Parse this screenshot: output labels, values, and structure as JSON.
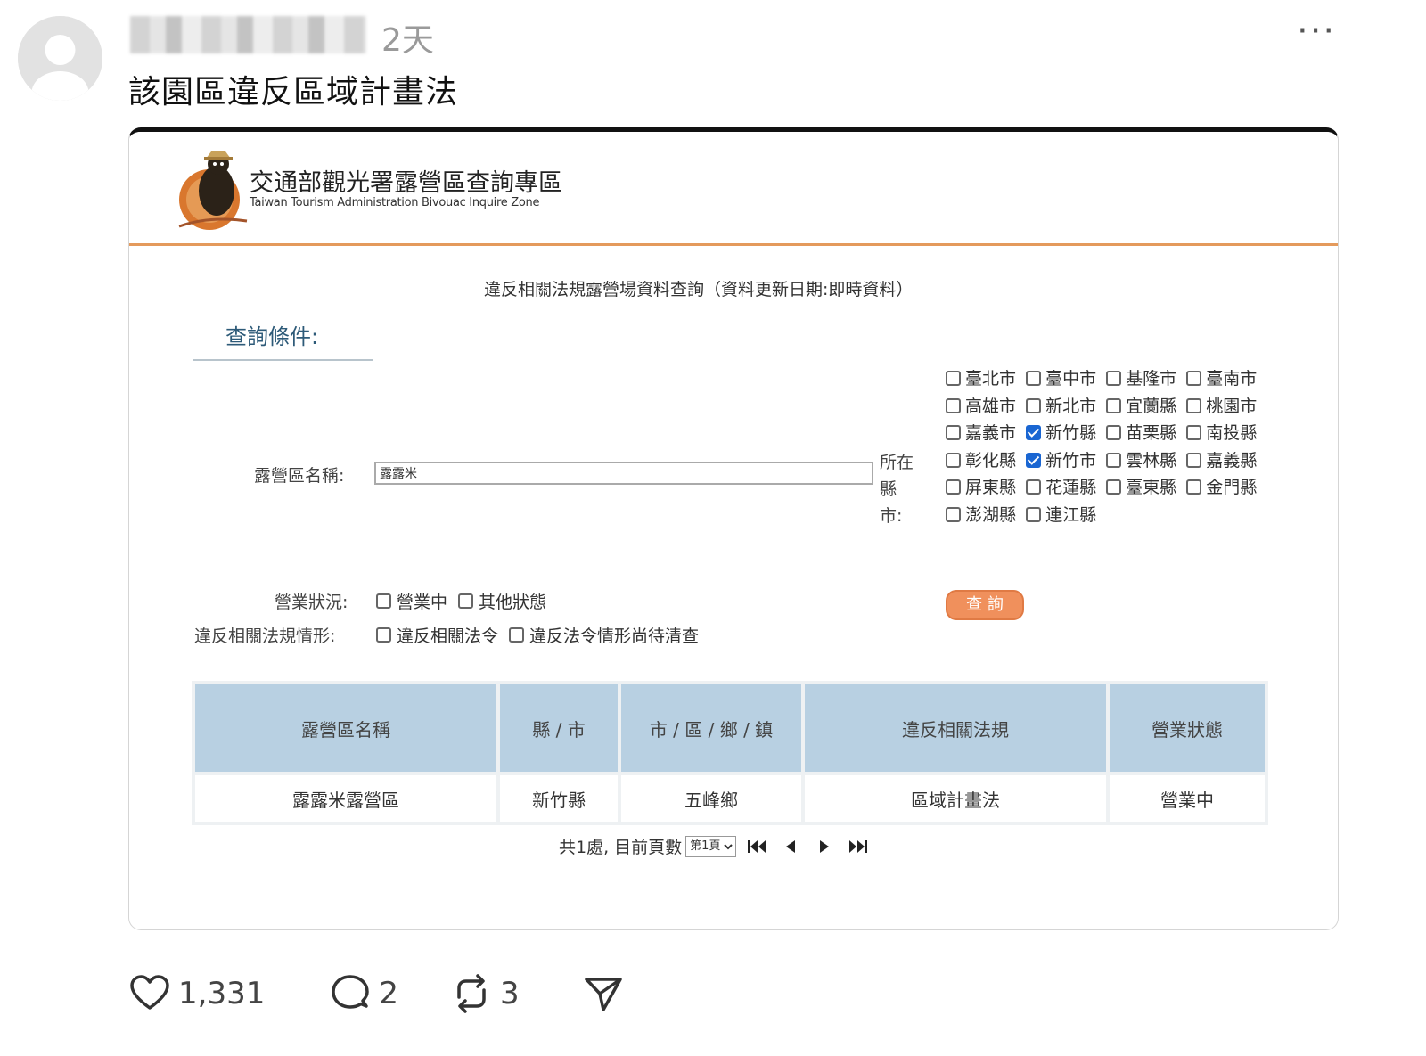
{
  "post": {
    "time": "2天",
    "more_label": "···",
    "text": "該園區違反區域計畫法"
  },
  "site": {
    "title": "交通部觀光署露營區查詢專區",
    "subtitle": "Taiwan Tourism Administration Bivouac Inquire Zone"
  },
  "form": {
    "heading": "違反相關法規露營場資料查詢（資料更新日期:即時資料）",
    "conditions_title": "查詢條件:",
    "name_label": "露營區名稱:",
    "name_value": "露露米",
    "county_label": "所在縣市:",
    "counties": [
      {
        "name": "臺北市",
        "checked": false
      },
      {
        "name": "臺中市",
        "checked": false
      },
      {
        "name": "基隆市",
        "checked": false
      },
      {
        "name": "臺南市",
        "checked": false
      },
      {
        "name": "高雄市",
        "checked": false
      },
      {
        "name": "新北市",
        "checked": false
      },
      {
        "name": "宜蘭縣",
        "checked": false
      },
      {
        "name": "桃園市",
        "checked": false
      },
      {
        "name": "嘉義市",
        "checked": false
      },
      {
        "name": "新竹縣",
        "checked": true
      },
      {
        "name": "苗栗縣",
        "checked": false
      },
      {
        "name": "南投縣",
        "checked": false
      },
      {
        "name": "彰化縣",
        "checked": false
      },
      {
        "name": "新竹市",
        "checked": true
      },
      {
        "name": "雲林縣",
        "checked": false
      },
      {
        "name": "嘉義縣",
        "checked": false
      },
      {
        "name": "屏東縣",
        "checked": false
      },
      {
        "name": "花蓮縣",
        "checked": false
      },
      {
        "name": "臺東縣",
        "checked": false
      },
      {
        "name": "金門縣",
        "checked": false
      },
      {
        "name": "澎湖縣",
        "checked": false
      },
      {
        "name": "連江縣",
        "checked": false
      }
    ],
    "status_label": "營業狀況:",
    "status_options": [
      "營業中",
      "其他狀態"
    ],
    "violation_label": "違反相關法規情形:",
    "violation_options": [
      "違反相關法令",
      "違反法令情形尚待清查"
    ],
    "search_label": "查 詢"
  },
  "table": {
    "headers": [
      "露營區名稱",
      "縣 / 市",
      "市 / 區 / 鄉 / 鎮",
      "違反相關法規",
      "營業狀態"
    ],
    "rows": [
      [
        "露露米露營區",
        "新竹縣",
        "五峰鄉",
        "區域計畫法",
        "營業中"
      ]
    ]
  },
  "pager": {
    "summary": "共1處, 目前頁數",
    "page_option": "第1頁"
  },
  "actions": {
    "likes": "1,331",
    "comments": "2",
    "reposts": "3"
  }
}
